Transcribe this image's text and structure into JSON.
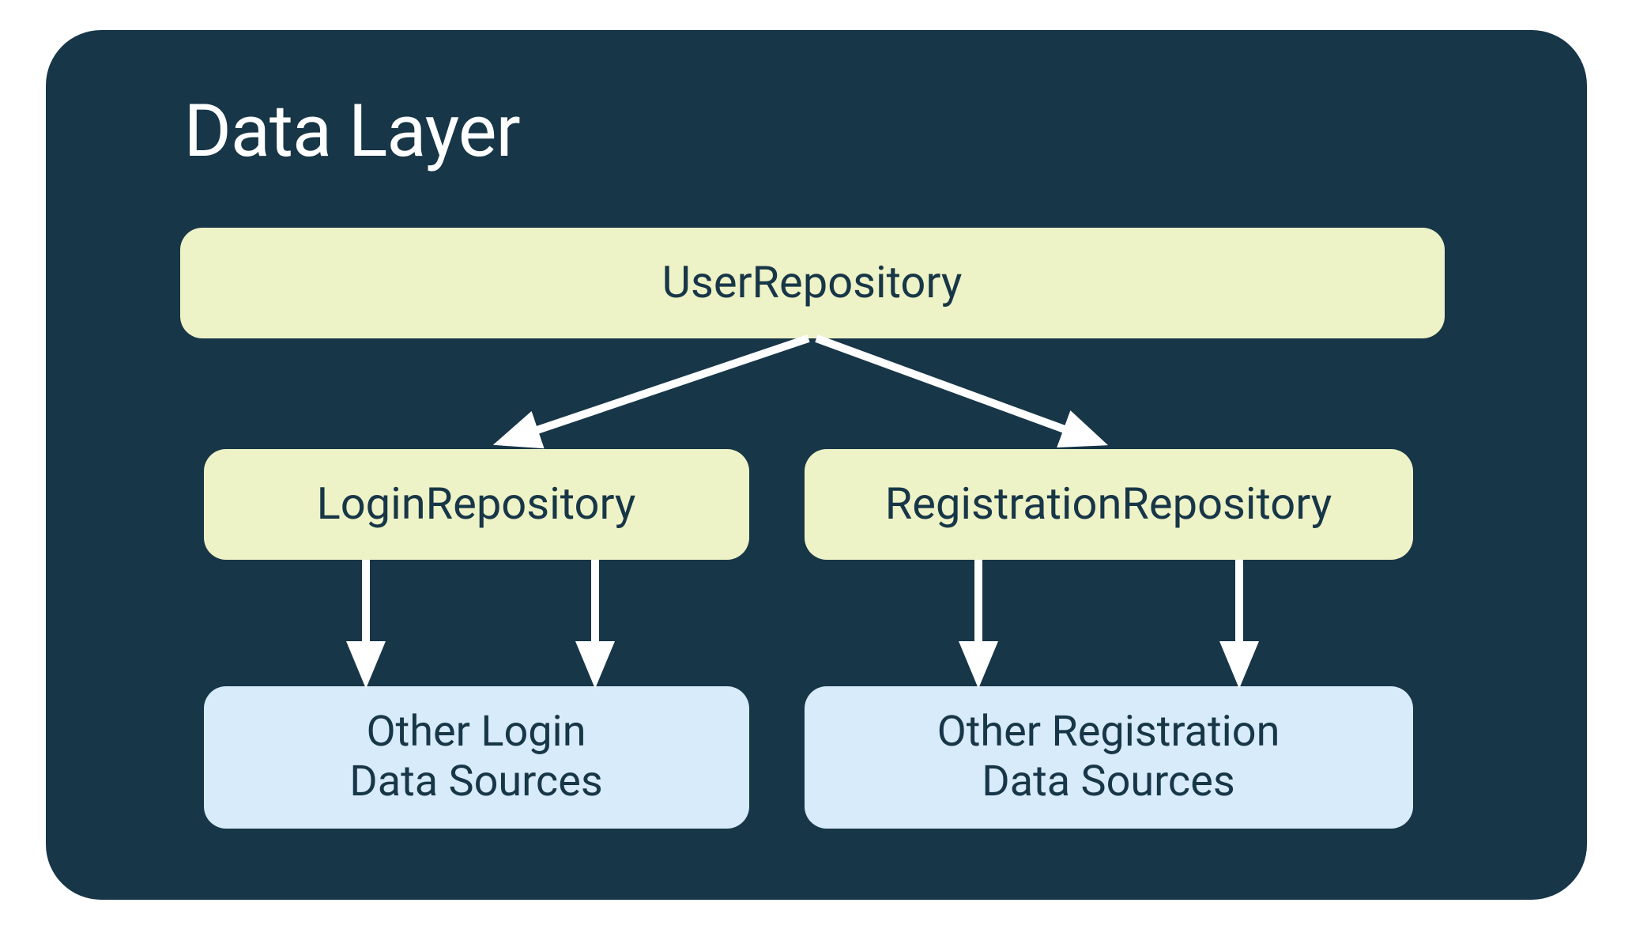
{
  "title": "Data Layer",
  "nodes": {
    "user_repository": "UserRepository",
    "login_repository": "LoginRepository",
    "registration_repository": "RegistrationRepository",
    "login_data_sources_line1": "Other Login",
    "login_data_sources_line2": "Data Sources",
    "registration_data_sources_line1": "Other Registration",
    "registration_data_sources_line2": "Data Sources"
  },
  "colors": {
    "background": "#173647",
    "repository_box": "#eef2c7",
    "datasource_box": "#d7ebfa",
    "arrow": "#ffffff",
    "text_dark": "#173647",
    "text_light": "#ffffff"
  },
  "edges": [
    {
      "from": "user_repository",
      "to": "login_repository"
    },
    {
      "from": "user_repository",
      "to": "registration_repository"
    },
    {
      "from": "login_repository",
      "to": "login_data_sources"
    },
    {
      "from": "login_repository",
      "to": "login_data_sources"
    },
    {
      "from": "registration_repository",
      "to": "registration_data_sources"
    },
    {
      "from": "registration_repository",
      "to": "registration_data_sources"
    }
  ]
}
